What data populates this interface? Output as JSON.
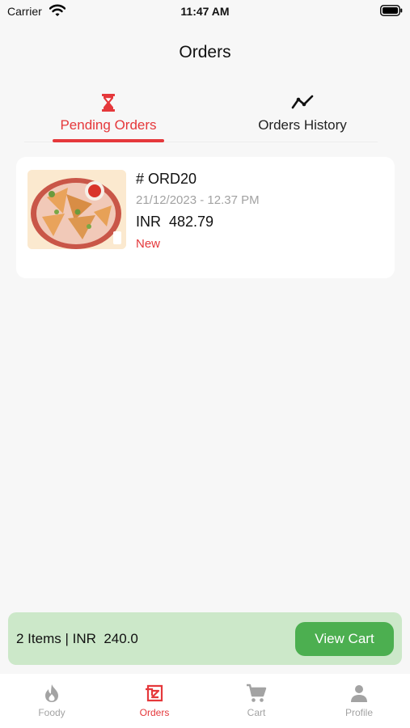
{
  "status_bar": {
    "carrier": "Carrier",
    "time": "11:47 AM"
  },
  "header": {
    "title": "Orders"
  },
  "tabs": [
    {
      "label": "Pending Orders",
      "icon": "hourglass-icon",
      "active": true
    },
    {
      "label": "Orders History",
      "icon": "trend-line-icon",
      "active": false
    }
  ],
  "orders": [
    {
      "id": "# ORD20",
      "date": "21/12/2023 - 12.37 PM",
      "amount": "INR  482.79",
      "status": "New",
      "image": "samosa-plate-image"
    }
  ],
  "cart_bar": {
    "summary": "2 Items | INR  240.0",
    "button_label": "View Cart"
  },
  "bottom_nav": [
    {
      "label": "Foody",
      "icon": "flame-icon",
      "active": false
    },
    {
      "label": "Orders",
      "icon": "orders-icon",
      "active": true
    },
    {
      "label": "Cart",
      "icon": "cart-icon",
      "active": false
    },
    {
      "label": "Profile",
      "icon": "person-icon",
      "active": false
    }
  ],
  "colors": {
    "accent": "#e5383b",
    "cart_bar_bg": "#cce8c9",
    "cart_button": "#4caf50",
    "inactive": "#a3a3a3"
  }
}
